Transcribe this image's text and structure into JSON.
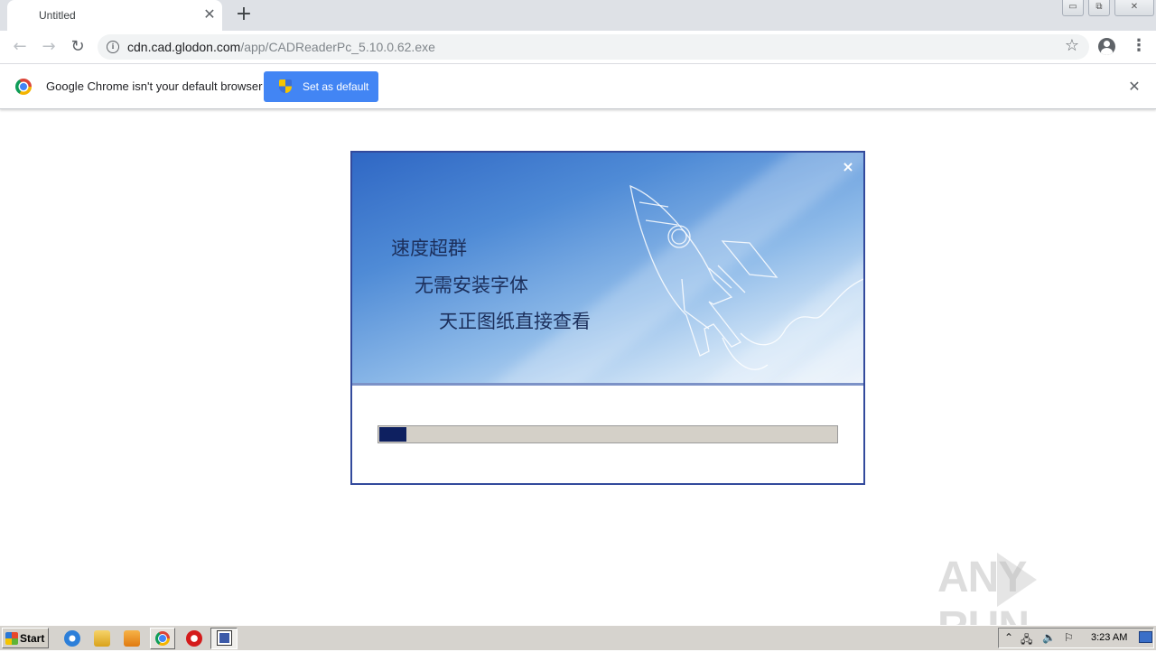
{
  "browser": {
    "tab": {
      "title": "Untitled",
      "close_glyph": "✕"
    },
    "new_tab_glyph": "+",
    "window_controls": [
      "▭",
      "⧉",
      "✕"
    ],
    "nav": {
      "back_icon": "arrow-left-icon",
      "forward_icon": "arrow-right-icon",
      "reload_icon": "reload-icon",
      "back_glyph": "←",
      "forward_glyph": "→",
      "reload_glyph": "↻"
    },
    "omnibox": {
      "host": "cdn.cad.glodon.com",
      "path": "/app/CADReaderPc_5.10.0.62.exe",
      "info_glyph": "i"
    },
    "star_glyph": "☆",
    "menu_glyph": "⋮"
  },
  "infobar": {
    "message": "Google Chrome isn't your default browser",
    "button_label": "Set as default",
    "close_glyph": "✕"
  },
  "installer": {
    "close_glyph": "×",
    "lines": [
      "速度超群",
      "无需安装字体",
      "天正图纸直接查看"
    ],
    "progress_fraction": 0.06,
    "colors": {
      "banner_top": "#2f67c4",
      "progress_fill": "#0e2060",
      "border": "#334a9c"
    }
  },
  "watermark": {
    "text_left": "ANY",
    "text_right": "RUN"
  },
  "taskbar": {
    "start_label": "Start",
    "clock": "3:23 AM",
    "tray": [
      "⌃",
      "🖧",
      "🔈",
      "⚐"
    ]
  }
}
